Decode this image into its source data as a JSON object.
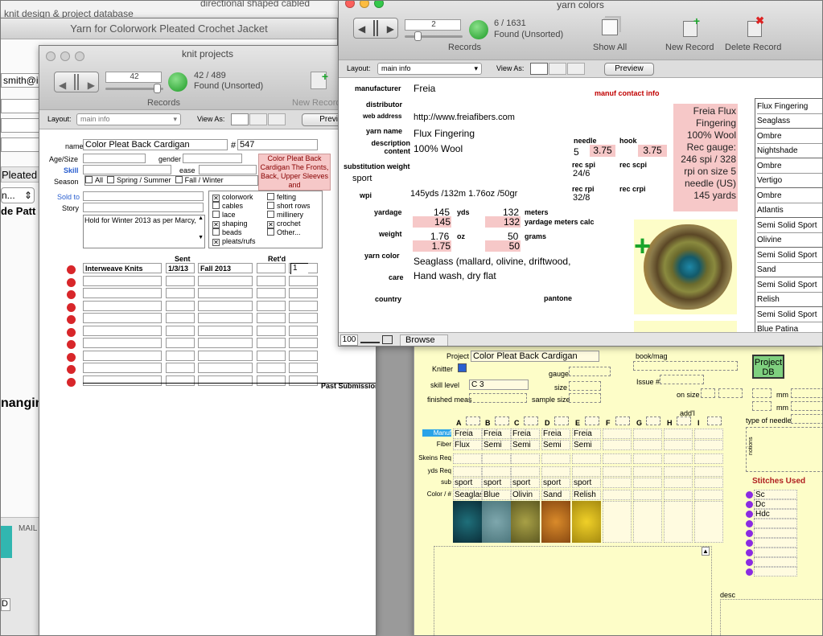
{
  "bg1": {
    "title": "knit design & project database",
    "sub": "directional shaped cabled"
  },
  "jacket": {
    "title": "Yarn for Colorwork Pleated Crochet Jacket",
    "email": "smith@i",
    "pleated": "Pleated",
    "select": "n...",
    "frag1": "de Patt",
    "changing": "nanging",
    "mail": "MAIL",
    "d": "D"
  },
  "kp": {
    "title": "knit projects",
    "record": "42",
    "count": "42 / 489",
    "found": "Found (Unsorted)",
    "records_label": "Records",
    "new_record": "New Record",
    "layout_label": "Layout:",
    "layout_value": "main info",
    "view_as": "View As:",
    "preview": "Preview",
    "name_label": "name",
    "name_value": "Color Pleat Back Cardigan",
    "hash": "#",
    "number": "547",
    "age_label": "Age/Size",
    "gender_label": "gender",
    "skill_label": "Skill",
    "ease_label": "ease",
    "season_label": "Season",
    "seasons": [
      "All",
      "Spring / Summer",
      "Fall / Winter"
    ],
    "sold_label": "Sold to",
    "story_label": "Story",
    "notes": "Hold for Winter 2013 as per Marcy,",
    "pink_note": "Color Pleat Back Cardigan The Fronts, Back, Upper Sleeves and",
    "tags_left": [
      {
        "t": "colorwork",
        "c": true
      },
      {
        "t": "cables",
        "c": false
      },
      {
        "t": "lace",
        "c": false
      },
      {
        "t": "shaping",
        "c": true
      },
      {
        "t": "beads",
        "c": false
      },
      {
        "t": "pleats/rufs",
        "c": true
      }
    ],
    "tags_right": [
      {
        "t": "felting",
        "c": false
      },
      {
        "t": "short rows",
        "c": false
      },
      {
        "t": "millinery",
        "c": false
      },
      {
        "t": "crochet",
        "c": true
      },
      {
        "t": "Other...",
        "c": false
      }
    ],
    "sub_head_sent": "Sent",
    "sub_head_retd": "Ret'd",
    "sub_row": {
      "pub": "Interweave Knits",
      "sent": "1/3/13",
      "issue": "Fall 2013",
      "num": "1"
    },
    "past": "Past Submissions"
  },
  "yc": {
    "title": "yarn colors",
    "record": "2",
    "count": "6 / 1631",
    "found": "Found (Unsorted)",
    "records_label": "Records",
    "show_all": "Show All",
    "new_record": "New Record",
    "delete_record": "Delete Record",
    "layout_label": "Layout:",
    "layout_value": "main info",
    "view_as": "View As:",
    "preview": "Preview",
    "manufacturer_label": "manufacturer",
    "manufacturer": "Freia",
    "manuf_contact": "manuf contact info",
    "distributor_label": "distributor",
    "web_label": "web address",
    "web": "http://www.freiafibers.com",
    "yarn_name_label": "yarn name",
    "yarn_name": "Flux Fingering",
    "desc_label": "description content",
    "desc": "100% Wool",
    "subst_label": "substitution weight",
    "subst": "sport",
    "wpi_label": "wpi",
    "weight_note": "145yds /132m  1.76oz /50gr",
    "needle_label": "needle",
    "needle": "5",
    "needle_mm": "3.75",
    "hook_label": "hook",
    "hook": "3.75",
    "rec_spi_label": "rec spi",
    "rec_spi": "24/6",
    "rec_scpi_label": "rec scpi",
    "rec_rpi_label": "rec rpi",
    "rec_rpi": "32/8",
    "rec_crpi_label": "rec crpi",
    "yardage_label": "yardage",
    "yards": "145",
    "yds_label": "yds",
    "yards_calc": "145",
    "meters": "132",
    "meters_label": "meters",
    "meters_calc": "132",
    "meters_calc_label": "yardage meters calc",
    "weight_label": "weight",
    "oz": "1.76",
    "oz_label": "oz",
    "oz_calc": "1.75",
    "grams": "50",
    "grams_label": "grams",
    "grams_calc": "50",
    "yarn_color_label": "yarn color",
    "yarn_color": "Seaglass (mallard, olivine, driftwood,",
    "care_label": "care",
    "care": "Hand wash, dry flat",
    "country_label": "country",
    "pantone_label": "pantone",
    "summary": "Freia Flux Fingering 100% Wool Rec gauge: 246 spi / 328 rpi on size 5 needle (US) 145 yards",
    "colors": [
      {
        "n": "Flux Fingering",
        "c": "Seaglass"
      },
      {
        "n": "Ombre",
        "c": "Nightshade"
      },
      {
        "n": "Ombre",
        "c": "Vertigo"
      },
      {
        "n": "Ombre",
        "c": "Atlantis"
      },
      {
        "n": "Semi Solid Sport",
        "c": "Olivine"
      },
      {
        "n": "Semi Solid Sport",
        "c": "Sand"
      },
      {
        "n": "Semi Solid Sport",
        "c": "Relish"
      },
      {
        "n": "Semi Solid Sport",
        "c": "Blue Patina"
      }
    ],
    "zoom": "100",
    "mode": "Browse"
  },
  "pdb": {
    "project_label": "Project",
    "project": "Color Pleat Back Cardigan",
    "book_label": "book/mag",
    "knitter_label": "Knitter",
    "gauge_label": "gauge",
    "issue_label": "Issue #",
    "skill_label": "skill level",
    "skill": "C 3",
    "size_label": "size",
    "finished_label": "finished meas",
    "sample_label": "sample size",
    "on_size_label": "on size",
    "mm1": "mm",
    "mm2": "mm",
    "add": "add'l",
    "type_needle": "type of needle",
    "notions": "notions",
    "desc_label": "desc",
    "button": "Project DB",
    "cols": [
      "A",
      "B",
      "C",
      "D",
      "E",
      "F",
      "G",
      "H",
      "I"
    ],
    "row_labels": [
      "Manuf",
      "Fiber",
      "Skeins Req",
      "yds Req",
      "sub",
      "Color / #"
    ],
    "manuf": [
      "Freia",
      "Freia",
      "Freia",
      "Freia",
      "Freia"
    ],
    "fiber": [
      "Flux",
      "Semi",
      "Semi",
      "Semi",
      "Semi"
    ],
    "sub": [
      "sport",
      "sport",
      "sport",
      "sport",
      "sport"
    ],
    "color": [
      "Seaglass",
      "Blue",
      "Olivin",
      "Sand",
      "Relish"
    ],
    "stitches_label": "Stitches Used",
    "stitches": [
      "Sc",
      "Dc",
      "Hdc"
    ]
  },
  "colors": {
    "accent_blue": "#2a5fd0",
    "pink": "#f6c8c8",
    "pale_yellow": "#fdfdc8",
    "green": "#2fbf3a",
    "red_dot": "#d8262a",
    "purple_dot": "#8a2be2"
  }
}
